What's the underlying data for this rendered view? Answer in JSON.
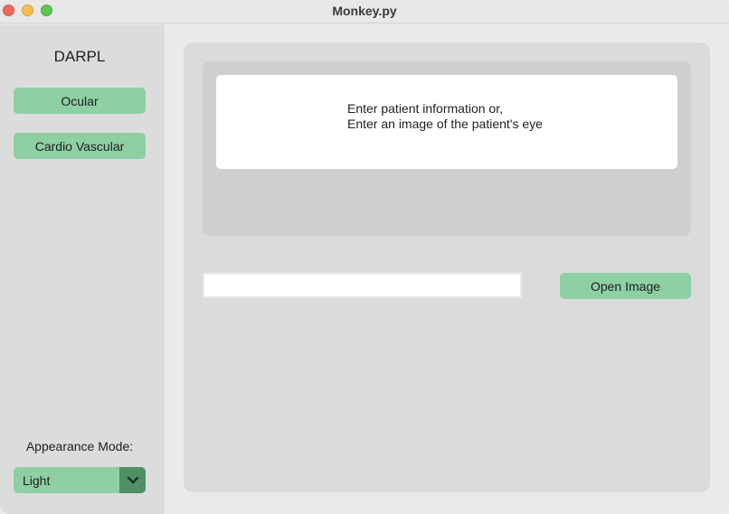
{
  "window": {
    "title": "Monkey.py"
  },
  "sidebar": {
    "logo": "DARPL",
    "buttons": [
      {
        "label": "Ocular"
      },
      {
        "label": "Cardio Vascular"
      }
    ],
    "appearance": {
      "label": "Appearance Mode:",
      "selected": "Light"
    }
  },
  "main": {
    "info_lines": [
      "Enter patient information or,",
      "Enter an image of the patient's eye"
    ],
    "entry": {
      "value": "",
      "placeholder": ""
    },
    "open_button_label": "Open Image"
  },
  "colors": {
    "accent": "#8fcfa4",
    "accent_dark": "#4f8f63",
    "sidebar_bg": "#dcdcdc",
    "panel_bg": "#dbdbdb",
    "frame_bg": "#cfcfcf"
  },
  "icons": {
    "dropdown": "chevron-down-icon"
  }
}
